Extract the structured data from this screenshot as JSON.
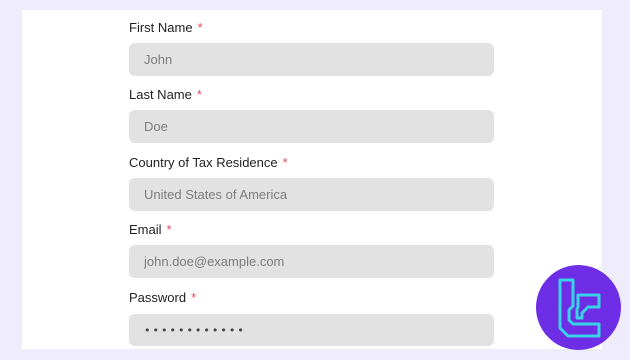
{
  "form": {
    "fields": [
      {
        "label": "First Name",
        "required_mark": "*",
        "placeholder": "John",
        "value": ""
      },
      {
        "label": "Last Name",
        "required_mark": "*",
        "placeholder": "Doe",
        "value": ""
      },
      {
        "label": "Country of Tax Residence",
        "required_mark": "*",
        "placeholder": "United States of America",
        "value": ""
      },
      {
        "label": "Email",
        "required_mark": "*",
        "placeholder": "john.doe@example.com",
        "value": ""
      },
      {
        "label": "Password",
        "required_mark": "*",
        "placeholder": "",
        "value": "••••••••••••"
      }
    ]
  },
  "logo": {
    "icon": "brand-logo-icon",
    "background_color": "#6d2ee6",
    "stroke_color": "#38d3e6"
  },
  "colors": {
    "page_background": "#efedfb",
    "panel_background": "#ffffff",
    "input_background": "#e2e2e2",
    "required_mark": "#e84a5f"
  }
}
